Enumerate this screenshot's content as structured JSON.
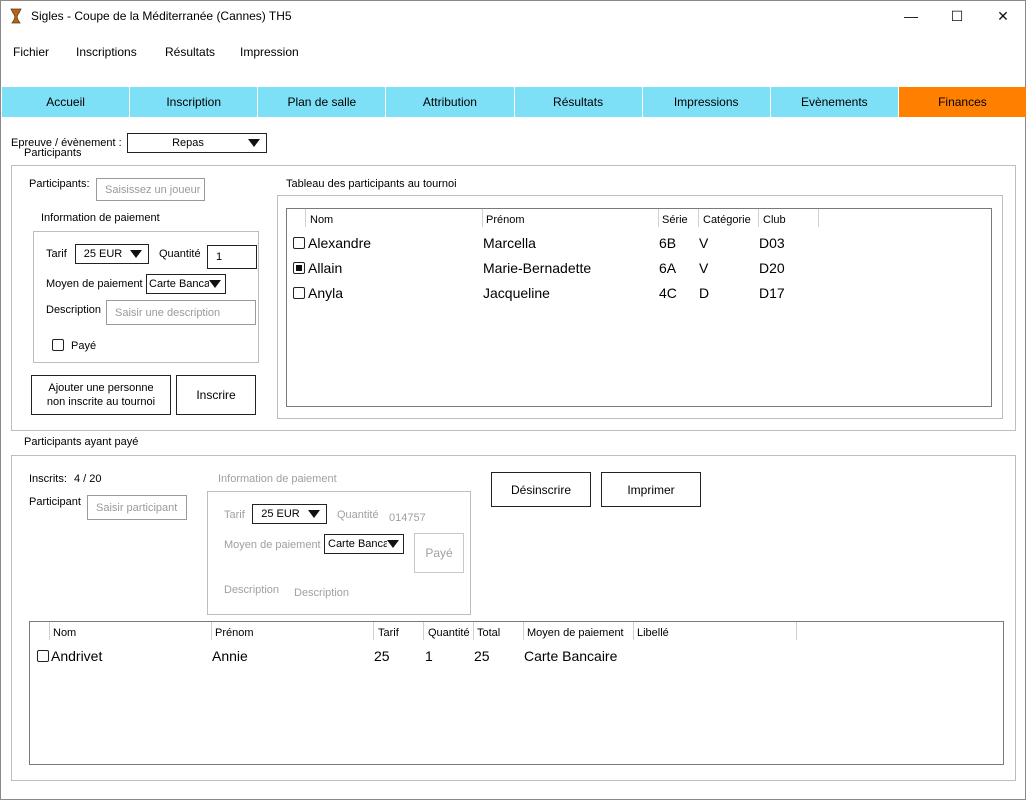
{
  "window": {
    "title": "Sigles - Coupe de la Méditerranée (Cannes) TH5",
    "minimize": "—",
    "maximize": "☐",
    "close": "✕"
  },
  "menu": [
    "Fichier",
    "Inscriptions",
    "Résultats",
    "Impression"
  ],
  "tabs": [
    {
      "label": "Accueil",
      "active": false
    },
    {
      "label": "Inscription",
      "active": false
    },
    {
      "label": "Plan de salle",
      "active": false
    },
    {
      "label": "Attribution",
      "active": false
    },
    {
      "label": "Résultats",
      "active": false
    },
    {
      "label": "Impressions",
      "active": false
    },
    {
      "label": "Evènements",
      "active": false
    },
    {
      "label": "Finances",
      "active": true
    }
  ],
  "colors": {
    "tab": "#7ee0f7",
    "tab_active": "#ff8000"
  },
  "event": {
    "label": "Epreuve / évènement :",
    "value": "Repas"
  },
  "participants": {
    "group_title": "Participants",
    "player_label": "Participants:",
    "player_placeholder": "Saisissez un joueur",
    "payment_group": "Information de paiement",
    "tarif_label": "Tarif",
    "tarif_value": "25 EUR",
    "quantity_label": "Quantité",
    "quantity_value": "1",
    "method_label": "Moyen de paiement",
    "method_value": "Carte Bancaire",
    "description_label": "Description",
    "description_placeholder": "Saisir une description",
    "paid_label": "Payé",
    "add_person_line1": "Ajouter une personne",
    "add_person_line2": "non inscrite au tournoi",
    "register_button": "Inscrire"
  },
  "tournament_table": {
    "title": "Tableau des participants au tournoi",
    "columns": [
      "Nom",
      "Prénom",
      "Série",
      "Catégorie",
      "Club"
    ],
    "rows": [
      {
        "checked": false,
        "nom": "Alexandre",
        "prenom": "Marcella",
        "serie": "6B",
        "categorie": "V",
        "club": "D03"
      },
      {
        "checked": true,
        "nom": "Allain",
        "prenom": "Marie-Bernadette",
        "serie": "6A",
        "categorie": "V",
        "club": "D20"
      },
      {
        "checked": false,
        "nom": "Anyla",
        "prenom": "Jacqueline",
        "serie": "4C",
        "categorie": "D",
        "club": "D17"
      }
    ]
  },
  "paid": {
    "group_title": "Participants ayant payé",
    "inscrits_label": "Inscrits:",
    "inscrits_value": "4 / 20",
    "participant_label": "Participant",
    "participant_placeholder": "Saisir participant",
    "payment_group": "Information de paiement",
    "tarif_label": "Tarif",
    "tarif_value": "25 EUR",
    "quantity_label": "Quantité",
    "quantity_value": "014757",
    "method_label": "Moyen de paiement",
    "method_value": "Carte Bancaire",
    "paid_button": "Payé",
    "description_label": "Description",
    "description_placeholder": "Description",
    "unregister_button": "Désinscrire",
    "print_button": "Imprimer",
    "columns": [
      "Nom",
      "Prénom",
      "Tarif",
      "Quantité",
      "Total",
      "Moyen de paiement",
      "Libellé"
    ],
    "rows": [
      {
        "checked": false,
        "nom": "Andrivet",
        "prenom": "Annie",
        "tarif": "25",
        "quantite": "1",
        "total": "25",
        "moyen": "Carte Bancaire",
        "libelle": ""
      }
    ]
  }
}
